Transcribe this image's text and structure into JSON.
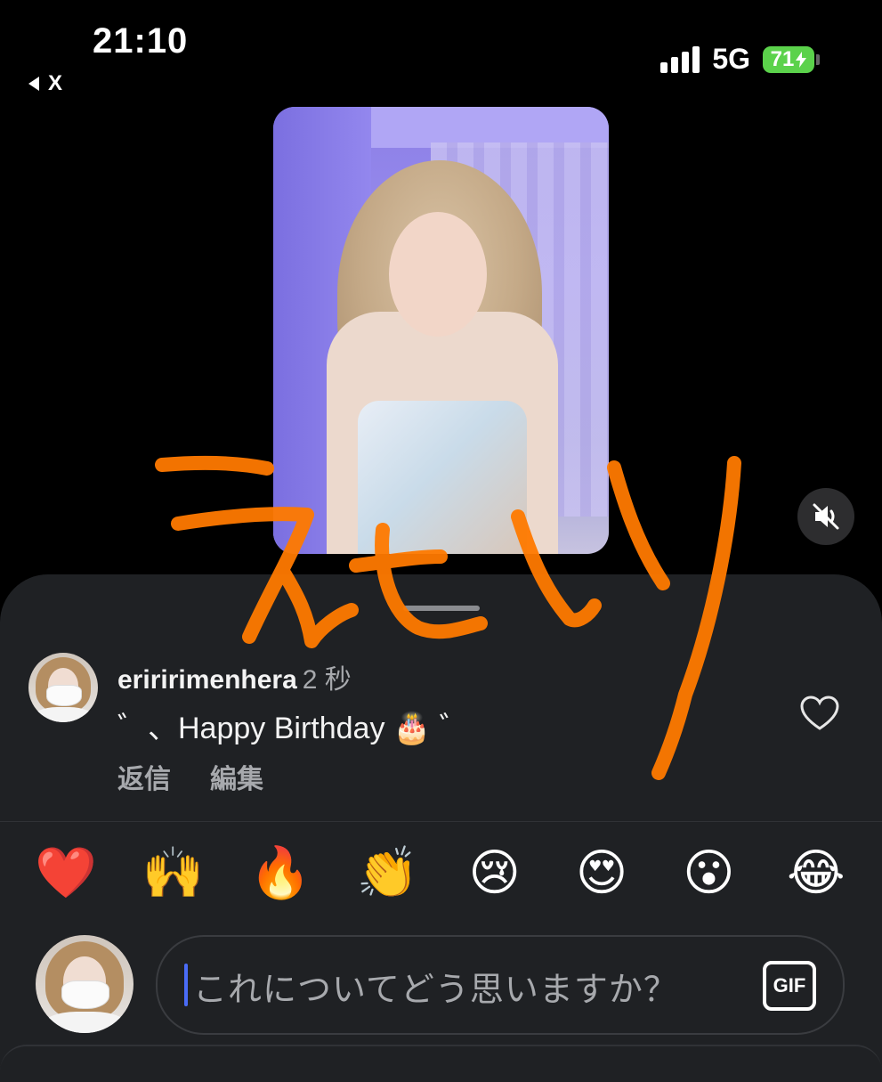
{
  "status_bar": {
    "time": "21:10",
    "back_app_label": "X",
    "network": "5G",
    "battery_level": "71",
    "signal_bars": 4
  },
  "video": {
    "mute_icon": "speaker-muted-icon"
  },
  "comments_sheet": {
    "comment": {
      "username": "eriririmenhera",
      "time": "2 秒",
      "text": "゛、Happy Birthday 🎂 ゛",
      "reply_label": "返信",
      "edit_label": "編集"
    },
    "quick_reactions": [
      "❤️",
      "🙌",
      "🔥",
      "👏",
      "😢",
      "😍",
      "😮",
      "😂"
    ],
    "input": {
      "placeholder": "これについてどう思いますか？",
      "gif_label": "GIF"
    }
  },
  "overlay": {
    "handwritten_text": "えむり",
    "color": "#ff7a00"
  },
  "colors": {
    "background": "#000000",
    "sheet": "#1f2124",
    "muted_text": "#a7a9ad",
    "battery": "#5bd24b",
    "caret": "#4a6cf7"
  }
}
